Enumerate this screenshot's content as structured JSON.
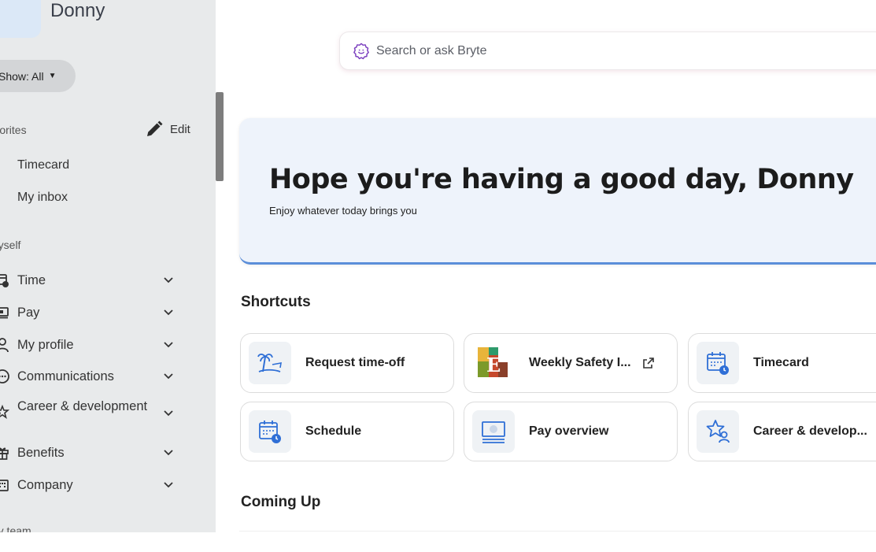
{
  "user": {
    "name": "Donny"
  },
  "sidebar": {
    "show_filter": "Show: All",
    "favorites": {
      "title": "Favorites",
      "edit_label": "Edit",
      "items": [
        {
          "label": "Timecard"
        },
        {
          "label": "My inbox"
        }
      ]
    },
    "myself": {
      "title": "Myself",
      "items": [
        {
          "label": "Time",
          "icon": "time-icon"
        },
        {
          "label": "Pay",
          "icon": "pay-icon"
        },
        {
          "label": "My profile",
          "icon": "profile-icon"
        },
        {
          "label": "Communications",
          "icon": "communications-icon"
        },
        {
          "label": "Career & development",
          "icon": "career-icon"
        },
        {
          "label": "Benefits",
          "icon": "benefits-icon"
        },
        {
          "label": "Company",
          "icon": "company-icon"
        }
      ]
    },
    "my_team_title": "My team"
  },
  "search": {
    "placeholder": "Search or ask Bryte"
  },
  "hero": {
    "title": "Hope you're having a good day, Donny",
    "subtitle": "Enjoy whatever today brings you"
  },
  "shortcuts": {
    "title": "Shortcuts",
    "items": [
      {
        "label": "Request time-off",
        "icon": "time-off-icon"
      },
      {
        "label": "Weekly Safety I...",
        "icon": "weekly-safety-logo-icon",
        "external": true
      },
      {
        "label": "Timecard",
        "icon": "timecard-icon"
      },
      {
        "label": "Schedule",
        "icon": "schedule-icon"
      },
      {
        "label": "Pay overview",
        "icon": "pay-overview-icon"
      },
      {
        "label": "Career & develop...",
        "icon": "career-development-icon"
      }
    ]
  },
  "coming_up": {
    "title": "Coming Up"
  },
  "colors": {
    "accent": "#2f6fd6",
    "hero_bg": "#eef3fb",
    "sidebar_bg": "#e8eaeb"
  }
}
